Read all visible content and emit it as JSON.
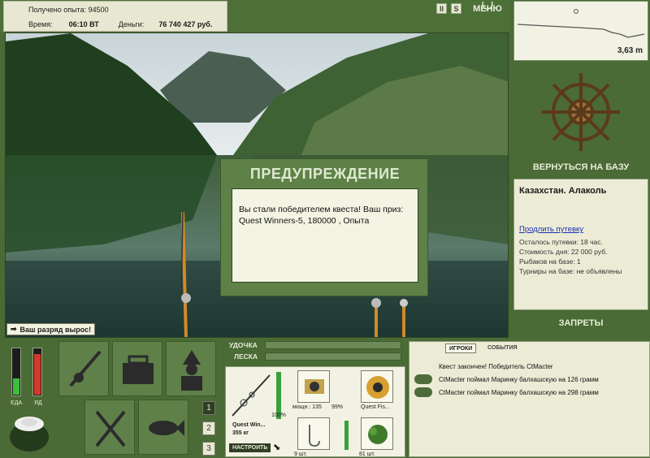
{
  "stats": {
    "exp_label": "Получено опыта: 94500",
    "time_label": "Время:",
    "time_value": "06:10 ВТ",
    "money_label": "Деньги:",
    "money_value": "76 740 427 руб."
  },
  "topbar": {
    "pause_icon": "II",
    "settings_icon": "S",
    "menu_label": "МЕНЮ"
  },
  "depth": {
    "value": "3,63 m"
  },
  "rank_message": "Ваш разряд вырос!",
  "dialog": {
    "title": "ПРЕДУПРЕЖДЕНИЕ",
    "text": "Вы стали победителем квеста! Ваш приз: Quest Winners-5, 180000 , Опыта"
  },
  "right_panel": {
    "return_label": "ВЕРНУТЬСЯ НА БАЗУ",
    "location": "Казахстан. Алаколь",
    "extend_link": "Продлить путевку",
    "days_left": "Осталось путевки: 18 час.",
    "day_cost": "Стоимость дня: 22 000 руб.",
    "anglers": "Рыбаков на базе: 1",
    "tournaments": "Турниры на базе: не объявлены",
    "bans_label": "ЗАПРЕТЫ"
  },
  "meters": {
    "food_label": "ЕДА",
    "poison_label": "ЯД",
    "food_level": 0.35,
    "poison_level": 0.9
  },
  "tackle_bars": {
    "rod_label": "УДОЧКА",
    "line_label": "ЛЕСКА"
  },
  "slots": [
    "1",
    "2",
    "3"
  ],
  "tackle": {
    "rod_name": "Quest Win...",
    "rod_weight": "355 кг",
    "rod_pct": "100%",
    "setup_label": "НАСТРОИТЬ",
    "reel_power": "мощн.: 135",
    "reel_pct": "99%",
    "line_name": "Quest Fis...",
    "hooks_count": "9 шт.",
    "bait_count": "81 шт."
  },
  "events": {
    "tab_players": "ИГРОКИ",
    "tab_events": "СОБЫТИЯ",
    "lines": [
      "Квест закончен! Победитель CtMacter",
      "CtMacter поймал Маринку балхашскую на 126 грамм",
      "CtMacter поймал Маринку балхашскую на 298 грамм"
    ]
  },
  "colors": {
    "panel_green": "#4a6a36",
    "cream": "#ececd6",
    "link_blue": "#1a2fb0"
  },
  "icons": [
    "rod-icon",
    "tackle-box-icon",
    "fisherman-icon",
    "cutlery-icon",
    "fish-icon",
    "pot-icon",
    "ship-wheel-icon"
  ]
}
